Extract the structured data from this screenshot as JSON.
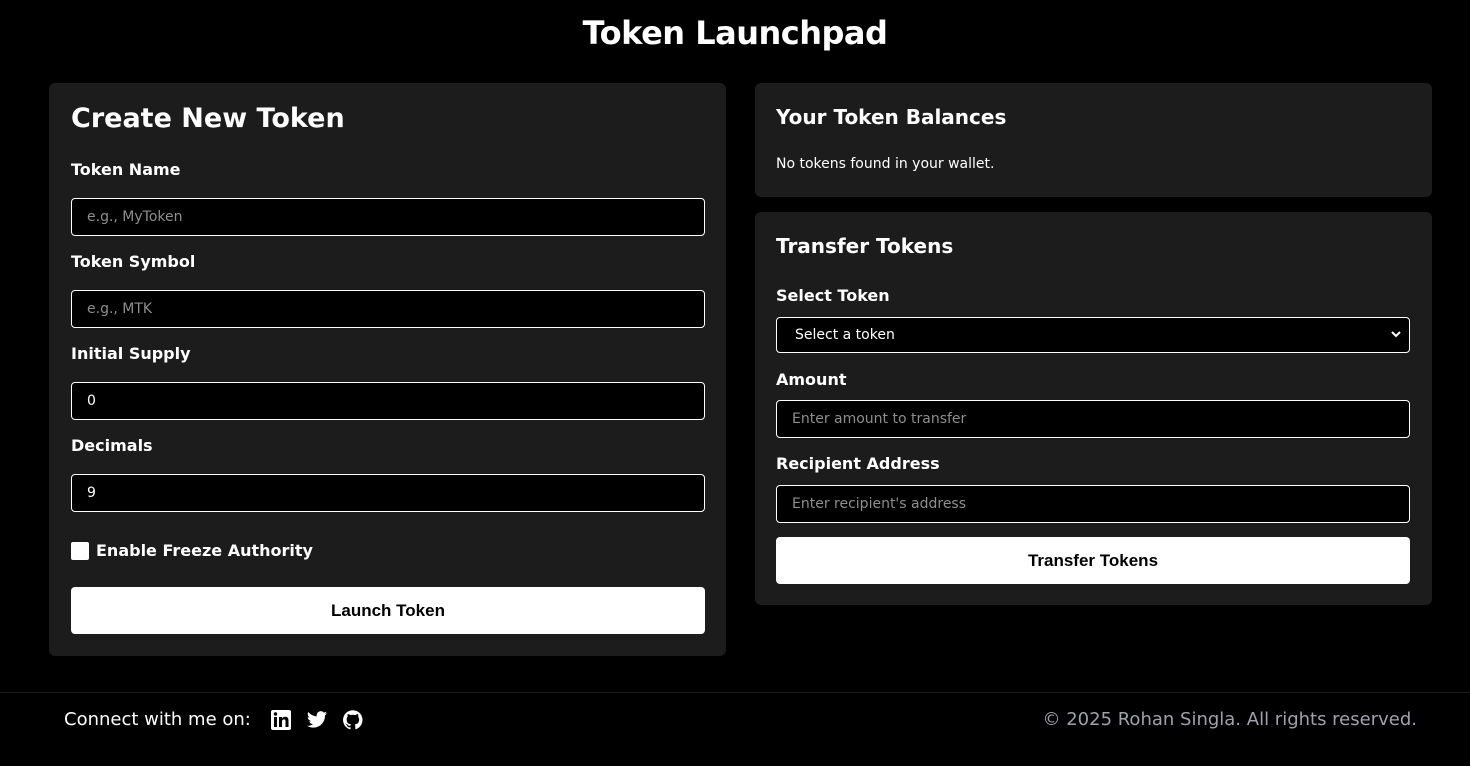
{
  "header": {
    "title": "Token Launchpad"
  },
  "create": {
    "title": "Create New Token",
    "name_label": "Token Name",
    "name_placeholder": "e.g., MyToken",
    "symbol_label": "Token Symbol",
    "symbol_placeholder": "e.g., MTK",
    "supply_label": "Initial Supply",
    "supply_value": "0",
    "decimals_label": "Decimals",
    "decimals_value": "9",
    "freeze_label": "Enable Freeze Authority",
    "freeze_checked": false,
    "launch_button": "Launch Token"
  },
  "balances": {
    "title": "Your Token Balances",
    "empty_text": "No tokens found in your wallet."
  },
  "transfer": {
    "title": "Transfer Tokens",
    "select_label": "Select Token",
    "select_value": "Select a token",
    "amount_label": "Amount",
    "amount_placeholder": "Enter amount to transfer",
    "recipient_label": "Recipient Address",
    "recipient_placeholder": "Enter recipient's address",
    "transfer_button": "Transfer Tokens"
  },
  "footer": {
    "connect_text": "Connect with me on:",
    "social_icons": [
      "linkedin-icon",
      "twitter-icon",
      "github-icon"
    ],
    "copyright": "© 2025 Rohan Singla. All rights reserved."
  }
}
